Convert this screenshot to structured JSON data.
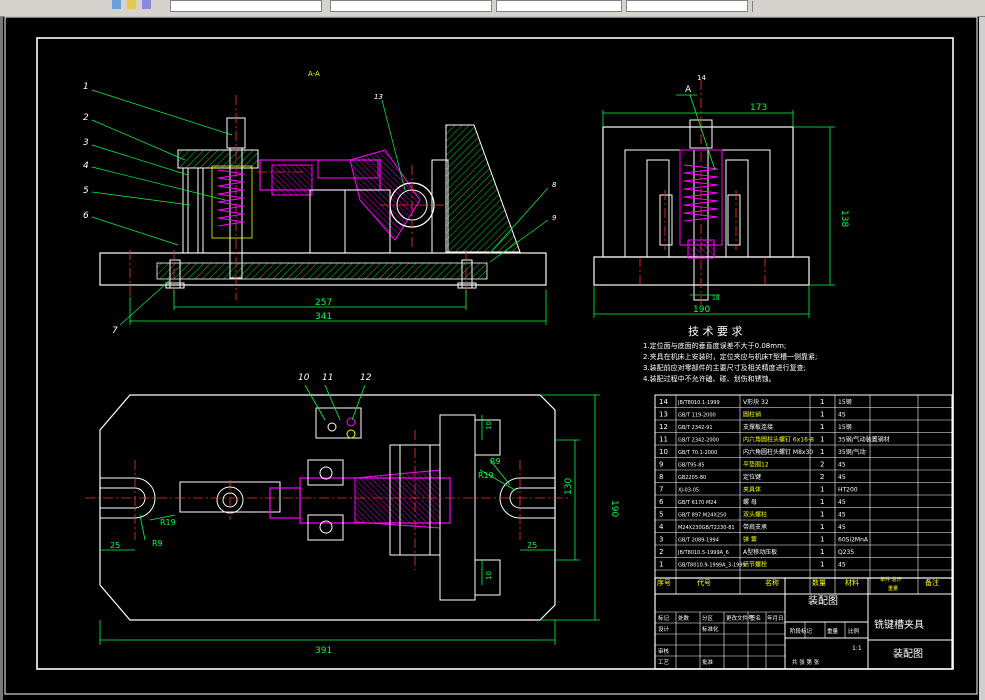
{
  "toolbar": {
    "fields": [
      "",
      "",
      "",
      "",
      "",
      ""
    ]
  },
  "drawing": {
    "section_label": "A-A",
    "view_label_A": "A",
    "dims": {
      "d257": "257",
      "d341": "341",
      "d173": "173",
      "d138": "138",
      "d190_top": "190",
      "d190_right": "190",
      "d391": "391",
      "d130": "130",
      "d25_left": "25",
      "d25_right": "25",
      "d10_top": "10",
      "d10_bottom": "10",
      "r19_left": "R19",
      "r9_left": "R9",
      "r19_right": "R19",
      "r9_right": "R9",
      "d18": "18"
    },
    "balloons": [
      "1",
      "2",
      "3",
      "4",
      "5",
      "6",
      "7",
      "8",
      "9",
      "10",
      "11",
      "12",
      "13",
      "14"
    ]
  },
  "tech": {
    "title": "技 术 要 求",
    "notes": [
      "1.定位面与底面的垂直度误差不大于0.08mm;",
      "2.夹具在机床上安装时，定位夹应与机床T型槽一侧靠紧;",
      "3.装配前应对零部件的主要尺寸及相关精度进行复查;",
      "4.装配过程中不允许磕、碰、划伤和锈蚀。"
    ]
  },
  "bom": {
    "rows": [
      {
        "no": "14",
        "code": "JB/T8010.1-1999",
        "name": "V形块 32",
        "qty": "1",
        "mat": "15钢"
      },
      {
        "no": "13",
        "code": "GB/T 119-2000",
        "name": "圆柱销",
        "qty": "1",
        "mat": "45"
      },
      {
        "no": "12",
        "code": "GB/T 2342-91",
        "name": "支撑板连接",
        "qty": "1",
        "mat": "15钢"
      },
      {
        "no": "11",
        "code": "GB/T 2342-2000",
        "name": "内六角圆柱头螺钉 6x16-8",
        "qty": "1",
        "mat": "35钢/气动装置钢材"
      },
      {
        "no": "10",
        "code": "GB/T 70.1-2000",
        "name": "内六角圆柱头螺钉 M8x30",
        "qty": "1",
        "mat": "35钢/气动"
      },
      {
        "no": "9",
        "code": "GB/T95-85",
        "name": "平垫圈12",
        "qty": "2",
        "mat": "45"
      },
      {
        "no": "8",
        "code": "GB2205-80",
        "name": "定位键",
        "qty": "2",
        "mat": "45"
      },
      {
        "no": "7",
        "code": "XJ-03-05",
        "name": "夹具体",
        "qty": "1",
        "mat": "HT200"
      },
      {
        "no": "6",
        "code": "GB/T 6170 M24",
        "name": "螺 母",
        "qty": "1",
        "mat": "45"
      },
      {
        "no": "5",
        "code": "GB/T 897 M24X250",
        "name": "双头螺柱",
        "qty": "1",
        "mat": "45"
      },
      {
        "no": "4",
        "code": "M24X230GB/T2230-81",
        "name": "带肩支承",
        "qty": "1",
        "mat": "45"
      },
      {
        "no": "3",
        "code": "GB/T 2089-1994",
        "name": "弹 簧",
        "qty": "1",
        "mat": "60Si2MnA"
      },
      {
        "no": "2",
        "code": "JB/T8010.5-1999A_6",
        "name": "A型移动压板",
        "qty": "1",
        "mat": "Q235"
      },
      {
        "no": "1",
        "code": "GB/T8010.9-1999A_3-1999",
        "name": "活节螺栓",
        "qty": "1",
        "mat": "45"
      }
    ],
    "header": {
      "no": "序号",
      "code": "代号",
      "name": "名称",
      "qty": "数量",
      "mat": "材料",
      "wt": "单件 总计",
      "wt2": "重量",
      "remark": "备注"
    }
  },
  "title_block": {
    "drawing_type": "装配图",
    "part_name": "铣键槽夹具",
    "bottom_label": "装配图",
    "scale": "1:1",
    "cells": [
      "标记",
      "处数",
      "分区",
      "更改文件号",
      "签名",
      "年月日",
      "设计",
      "标准化",
      "阶段标记",
      "重量",
      "比例",
      "审核",
      "工艺",
      "批准",
      "共 张 第 张"
    ]
  },
  "colors": {
    "background": "#000000",
    "line": "#ffffff",
    "center": "#ff3030",
    "dim": "#00ff40",
    "part": "#ff00ff",
    "hatch": "#00ff00",
    "yellow": "#ffff00",
    "cyan": "#00ffff"
  }
}
